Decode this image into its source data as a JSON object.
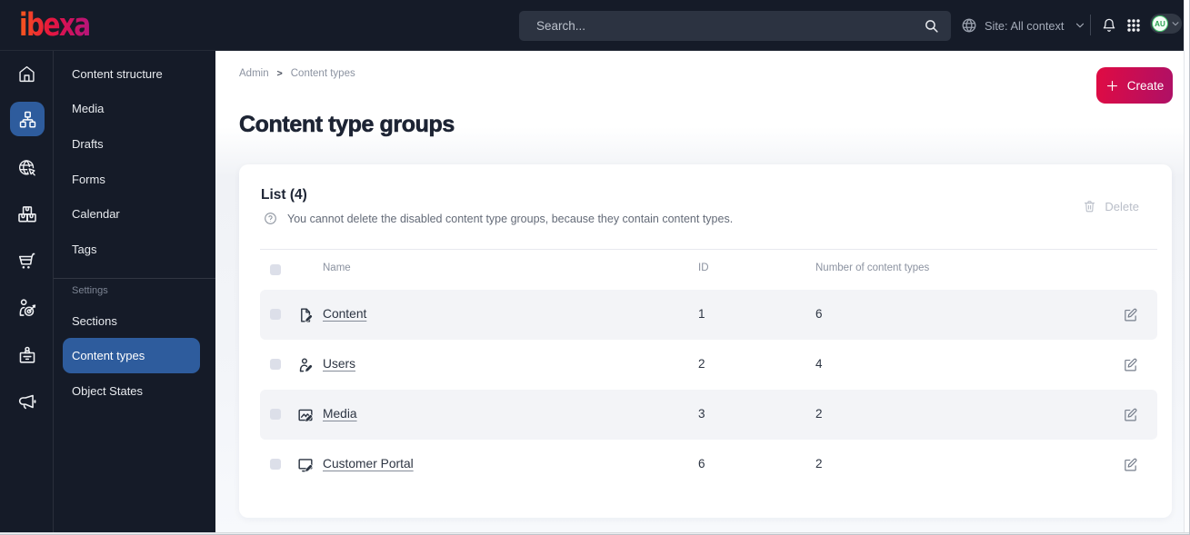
{
  "topbar": {
    "logo": "ibexa",
    "search_placeholder": "Search...",
    "site_context": "Site: All context",
    "avatar_initials": "AU"
  },
  "sidebar": {
    "items": [
      {
        "label": "Content structure"
      },
      {
        "label": "Media"
      },
      {
        "label": "Drafts"
      },
      {
        "label": "Forms"
      },
      {
        "label": "Calendar"
      },
      {
        "label": "Tags"
      }
    ],
    "settings_label": "Settings",
    "settings_items": [
      {
        "label": "Sections"
      },
      {
        "label": "Content types",
        "selected": true
      },
      {
        "label": "Object States"
      }
    ]
  },
  "breadcrumb": {
    "items": [
      "Admin",
      "Content types"
    ],
    "separator": ">"
  },
  "page": {
    "title": "Content type groups",
    "create_label": "Create"
  },
  "list_card": {
    "heading": "List (4)",
    "help_text": "You cannot delete the disabled content type groups, because they contain content types.",
    "delete_label": "Delete",
    "table": {
      "columns": {
        "name": "Name",
        "id": "ID",
        "count": "Number of content types"
      },
      "rows": [
        {
          "icon": "file-edit-icon",
          "name": "Content",
          "id": "1",
          "count": "6"
        },
        {
          "icon": "user-edit-icon",
          "name": "Users",
          "id": "2",
          "count": "4"
        },
        {
          "icon": "image-edit-icon",
          "name": "Media",
          "id": "3",
          "count": "2"
        },
        {
          "icon": "monitor-edit-icon",
          "name": "Customer Portal",
          "id": "6",
          "count": "2"
        }
      ]
    }
  },
  "colors": {
    "topbar": "#151b28",
    "accent_blue": "#2e5c9d",
    "create_gradient_start": "#e00b43",
    "create_gradient_end": "#ae1066",
    "avatar_green": "#2fae52",
    "stripe": "#f3f4f7"
  }
}
